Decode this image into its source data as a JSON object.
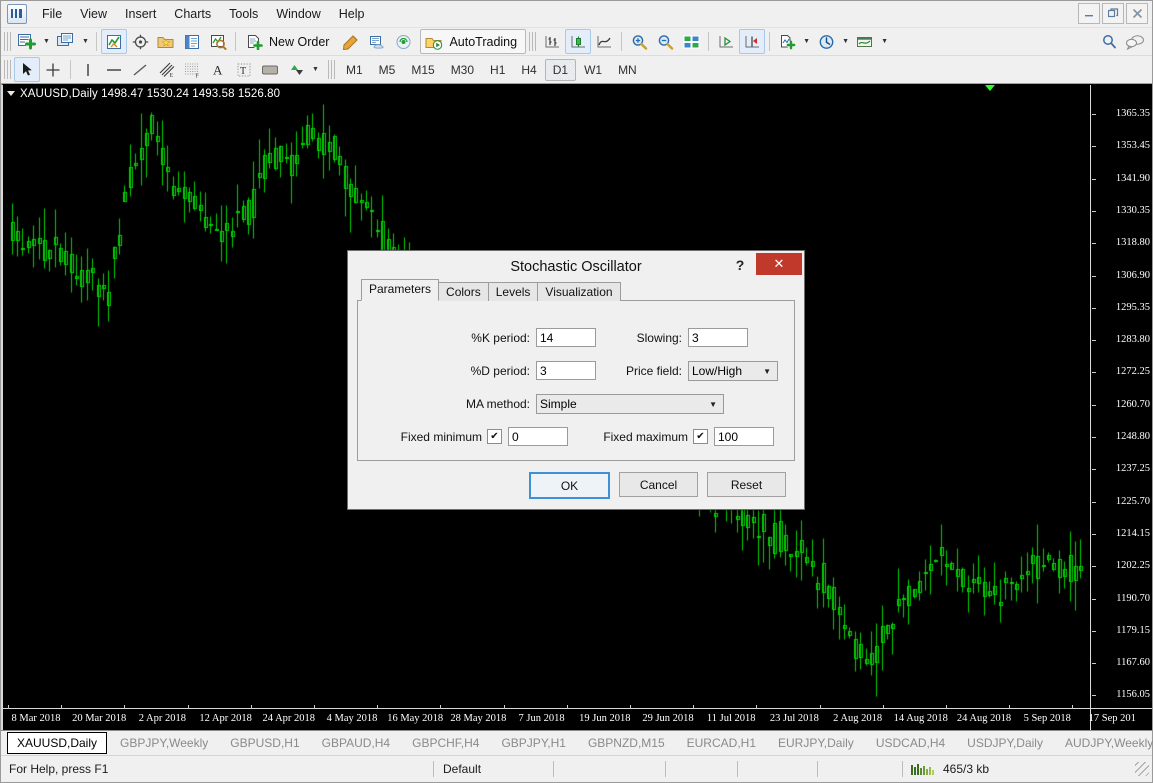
{
  "window": {
    "minimize_label": "–",
    "restore_label": "❐",
    "close_label": "✕"
  },
  "menu": {
    "items": [
      {
        "label": "File"
      },
      {
        "label": "View"
      },
      {
        "label": "Insert"
      },
      {
        "label": "Charts"
      },
      {
        "label": "Tools"
      },
      {
        "label": "Window"
      },
      {
        "label": "Help"
      }
    ]
  },
  "toolbar": {
    "new_order_label": "New Order",
    "autotrading_label": "AutoTrading",
    "icons": [
      "new-chart-icon",
      "chart-window-icon",
      "market-watch-icon",
      "navigator-icon",
      "data-folder-icon",
      "terminal-icon",
      "strategy-tester-icon",
      "new-order-icon",
      "metaeditor-icon",
      "mql5-community-icon",
      "signals-icon",
      "autotrading-icon",
      "bar-chart-icon",
      "candlestick-chart-icon",
      "line-chart-icon",
      "zoom-in-icon",
      "zoom-out-icon",
      "tile-windows-icon",
      "auto-scroll-icon",
      "chart-shift-icon",
      "indicators-icon",
      "period-icon",
      "templates-icon",
      "search-icon",
      "chat-icon"
    ]
  },
  "drawing_toolbar": {
    "tools": [
      "cursor-icon",
      "crosshair-icon",
      "vertical-line-icon",
      "horizontal-line-icon",
      "trendline-icon",
      "equidistant-channel-icon",
      "fibonacci-retracement-icon",
      "text-icon",
      "text-label-icon",
      "shapes-icon",
      "arrows-icon"
    ],
    "timeframes": [
      {
        "label": "M1",
        "selected": false
      },
      {
        "label": "M5",
        "selected": false
      },
      {
        "label": "M15",
        "selected": false
      },
      {
        "label": "M30",
        "selected": false
      },
      {
        "label": "H1",
        "selected": false
      },
      {
        "label": "H4",
        "selected": false
      },
      {
        "label": "D1",
        "selected": true
      },
      {
        "label": "W1",
        "selected": false
      },
      {
        "label": "MN",
        "selected": false
      }
    ]
  },
  "chart": {
    "header": "XAUUSD,Daily  1498.47 1530.24 1493.58 1526.80",
    "symbol": "XAUUSD",
    "timeframe": "Daily",
    "ohlc": {
      "open": "1498.47",
      "high": "1530.24",
      "low": "1493.58",
      "close": "1526.80"
    },
    "bullish_color": "#00d000",
    "background_color": "#000000",
    "price_labels": [
      "1365.35",
      "1353.45",
      "1341.90",
      "1330.35",
      "1318.80",
      "1306.90",
      "1295.35",
      "1283.80",
      "1272.25",
      "1260.70",
      "1248.80",
      "1237.25",
      "1225.70",
      "1214.15",
      "1202.25",
      "1190.70",
      "1179.15",
      "1167.60",
      "1156.05"
    ],
    "date_labels": [
      "8 Mar 2018",
      "20 Mar 2018",
      "2 Apr 2018",
      "12 Apr 2018",
      "24 Apr 2018",
      "4 May 2018",
      "16 May 2018",
      "28 May 2018",
      "7 Jun 2018",
      "19 Jun 2018",
      "29 Jun 2018",
      "11 Jul 2018",
      "23 Jul 2018",
      "2 Aug 2018",
      "14 Aug 2018",
      "24 Aug 2018",
      "5 Sep 2018",
      "17 Sep 201"
    ]
  },
  "chart_tabs": {
    "items": [
      {
        "label": "XAUUSD,Daily",
        "active": true
      },
      {
        "label": "GBPJPY,Weekly",
        "active": false
      },
      {
        "label": "GBPUSD,H1",
        "active": false
      },
      {
        "label": "GBPAUD,H4",
        "active": false
      },
      {
        "label": "GBPCHF,H4",
        "active": false
      },
      {
        "label": "GBPJPY,H1",
        "active": false
      },
      {
        "label": "GBPNZD,M15",
        "active": false
      },
      {
        "label": "EURCAD,H1",
        "active": false
      },
      {
        "label": "EURJPY,Daily",
        "active": false
      },
      {
        "label": "USDCAD,H4",
        "active": false
      },
      {
        "label": "USDJPY,Daily",
        "active": false
      },
      {
        "label": "AUDJPY,Weekly",
        "active": false
      }
    ],
    "nav_prev": "◄",
    "nav_next": "►"
  },
  "statusbar": {
    "help_text": "For Help, press F1",
    "profile": "Default",
    "connection": "465/3 kb"
  },
  "dialog": {
    "title": "Stochastic Oscillator",
    "help_label": "?",
    "close_label": "✕",
    "tabs": [
      {
        "label": "Parameters",
        "selected": true
      },
      {
        "label": "Colors",
        "selected": false
      },
      {
        "label": "Levels",
        "selected": false
      },
      {
        "label": "Visualization",
        "selected": false
      }
    ],
    "fields": {
      "k_period_label": "%K period:",
      "k_period_value": "14",
      "slowing_label": "Slowing:",
      "slowing_value": "3",
      "d_period_label": "%D period:",
      "d_period_value": "3",
      "price_field_label": "Price field:",
      "price_field_value": "Low/High",
      "ma_method_label": "MA method:",
      "ma_method_value": "Simple",
      "fixed_minimum_label": "Fixed minimum",
      "fixed_minimum_checked": "✔",
      "fixed_minimum_value": "0",
      "fixed_maximum_label": "Fixed maximum",
      "fixed_maximum_checked": "✔",
      "fixed_maximum_value": "100"
    },
    "buttons": {
      "ok": "OK",
      "cancel": "Cancel",
      "reset": "Reset"
    }
  }
}
